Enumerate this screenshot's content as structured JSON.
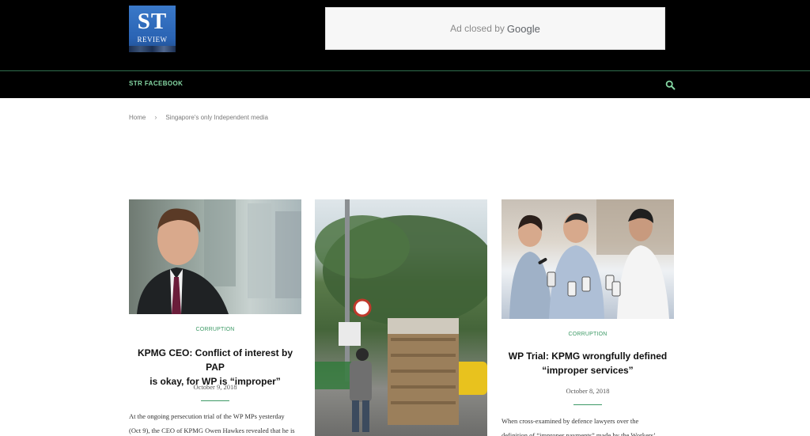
{
  "site": {
    "logo_main": "ST",
    "logo_sub": "REVIEW"
  },
  "ad": {
    "text": "Ad closed by",
    "brand": "Google"
  },
  "nav": {
    "facebook_label": "STR FACEBOOK",
    "search_icon": "search-icon"
  },
  "breadcrumb": {
    "home": "Home",
    "separator": "›",
    "current": "Singapore's only Independent media"
  },
  "posts": [
    {
      "category": "CORRUPTION",
      "title_line1": "KPMG CEO: Conflict of interest by PAP",
      "title_line2": "is okay, for WP is “improper”",
      "date": "October 9, 2018",
      "excerpt_line1": "At the ongoing persecution trial of the WP MPs yesterday",
      "excerpt_line2": "(Oct 9), the CEO of KPMG Owen Hawkes revealed that he is"
    },
    {
      "category": "",
      "title_line1": "",
      "title_line2": "",
      "date": "",
      "excerpt_line1": "",
      "excerpt_line2": ""
    },
    {
      "category": "CORRUPTION",
      "title_line1": "WP Trial: KPMG wrongfully defined",
      "title_line2": "“improper services”",
      "date": "October 8, 2018",
      "excerpt_line1": "When cross-examined by defence lawyers over the",
      "excerpt_line2": "definition of “improper payments” made by the Workers’"
    }
  ],
  "colors": {
    "accent": "#3d9a66",
    "nav_link": "#86d9a5",
    "header_bg": "#000000"
  }
}
